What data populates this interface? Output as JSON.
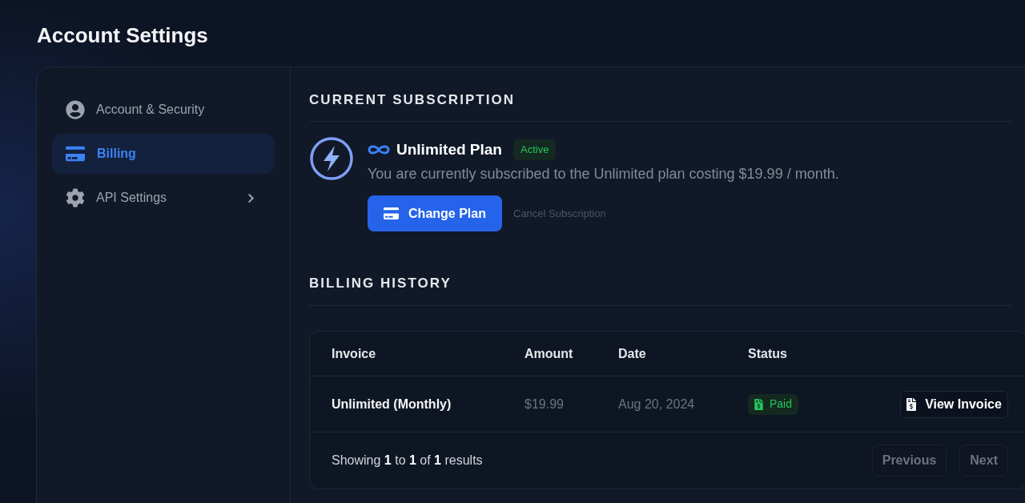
{
  "page": {
    "title": "Account Settings"
  },
  "sidebar": {
    "items": [
      {
        "label": "Account & Security",
        "selected": false,
        "expandable": false
      },
      {
        "label": "Billing",
        "selected": true,
        "expandable": false
      },
      {
        "label": "API Settings",
        "selected": false,
        "expandable": true
      }
    ]
  },
  "subscription": {
    "heading": "CURRENT SUBSCRIPTION",
    "plan_name": "Unlimited Plan",
    "status": "Active",
    "description": "You are currently subscribed to the Unlimited plan costing $19.99 / month.",
    "primary_button": "Change Plan",
    "secondary_link": "Cancel Subscription"
  },
  "billing_history": {
    "heading": "BILLING HISTORY",
    "table": {
      "columns": [
        "Invoice",
        "Amount",
        "Date",
        "Status"
      ],
      "rows": [
        {
          "invoice": "Unlimited (Monthly)",
          "amount": "$19.99",
          "date": "Aug 20, 2024",
          "status": "Paid",
          "action": "View Invoice"
        }
      ]
    },
    "footer": {
      "summary": "Showing **1** to **1** of **1** results",
      "buttons": [
        {
          "label": "Previous",
          "disabled": true
        },
        {
          "label": "Next",
          "disabled": true
        }
      ]
    }
  }
}
